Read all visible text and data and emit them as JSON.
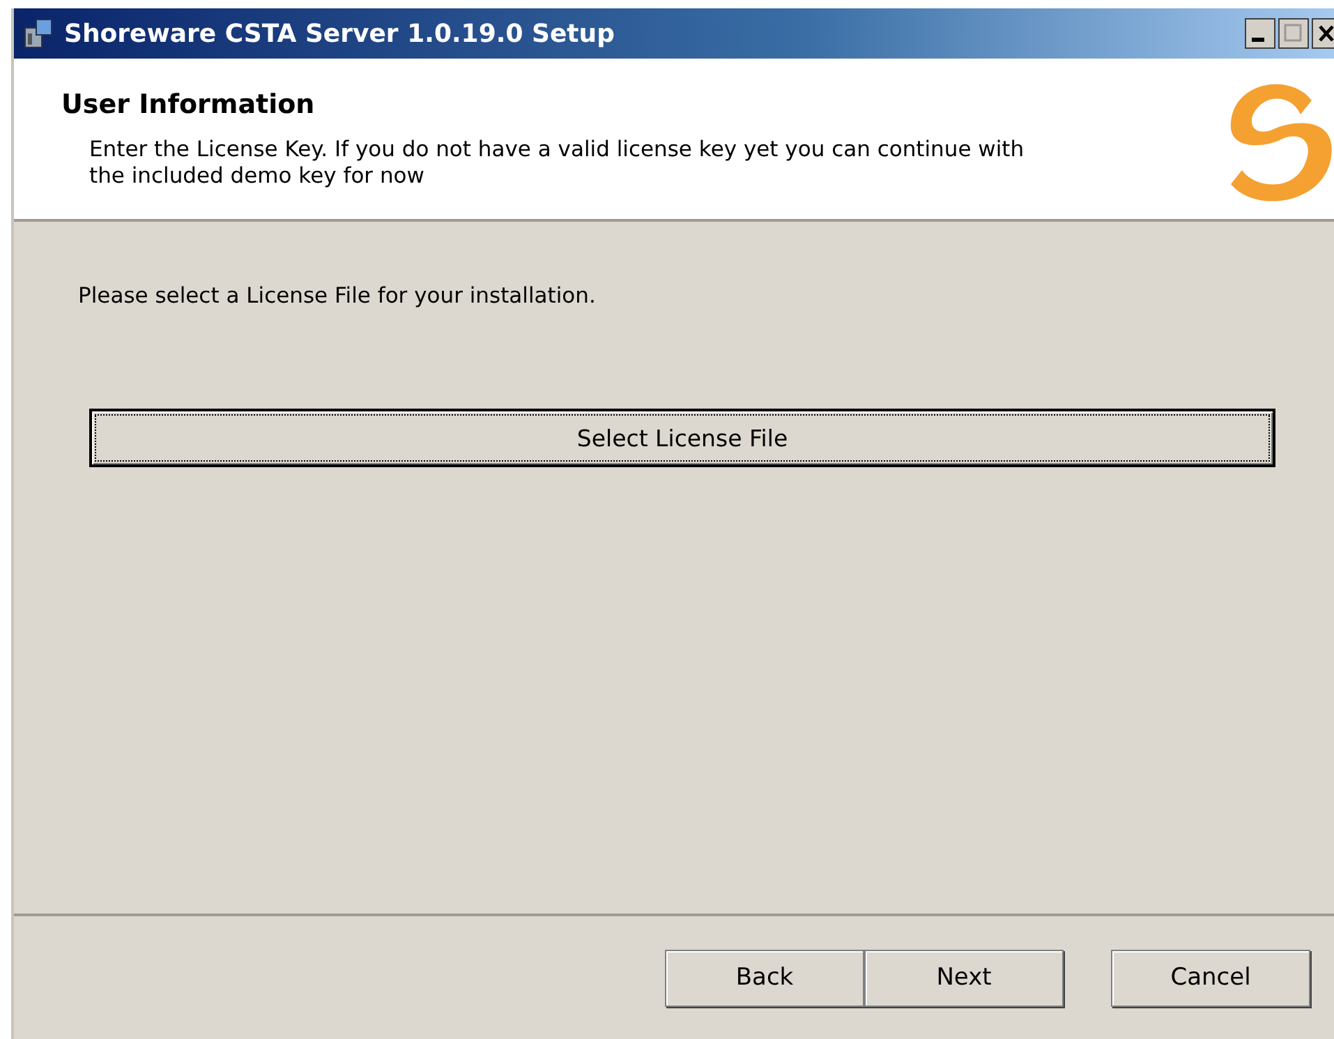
{
  "window": {
    "title": "Shoreware CSTA Server 1.0.19.0 Setup"
  },
  "header": {
    "title": "User Information",
    "description": "Enter the License Key. If you do not have a valid license key yet you can continue with the included demo key for now"
  },
  "body": {
    "prompt": "Please select a License File for your installation.",
    "select_button": {
      "label": "Select License File",
      "focused": true
    }
  },
  "buttons": [
    {
      "label": "Back",
      "kind": "nav"
    },
    {
      "label": "Next",
      "kind": "nav"
    },
    {
      "label": "Cancel",
      "kind": "cancel"
    }
  ]
}
